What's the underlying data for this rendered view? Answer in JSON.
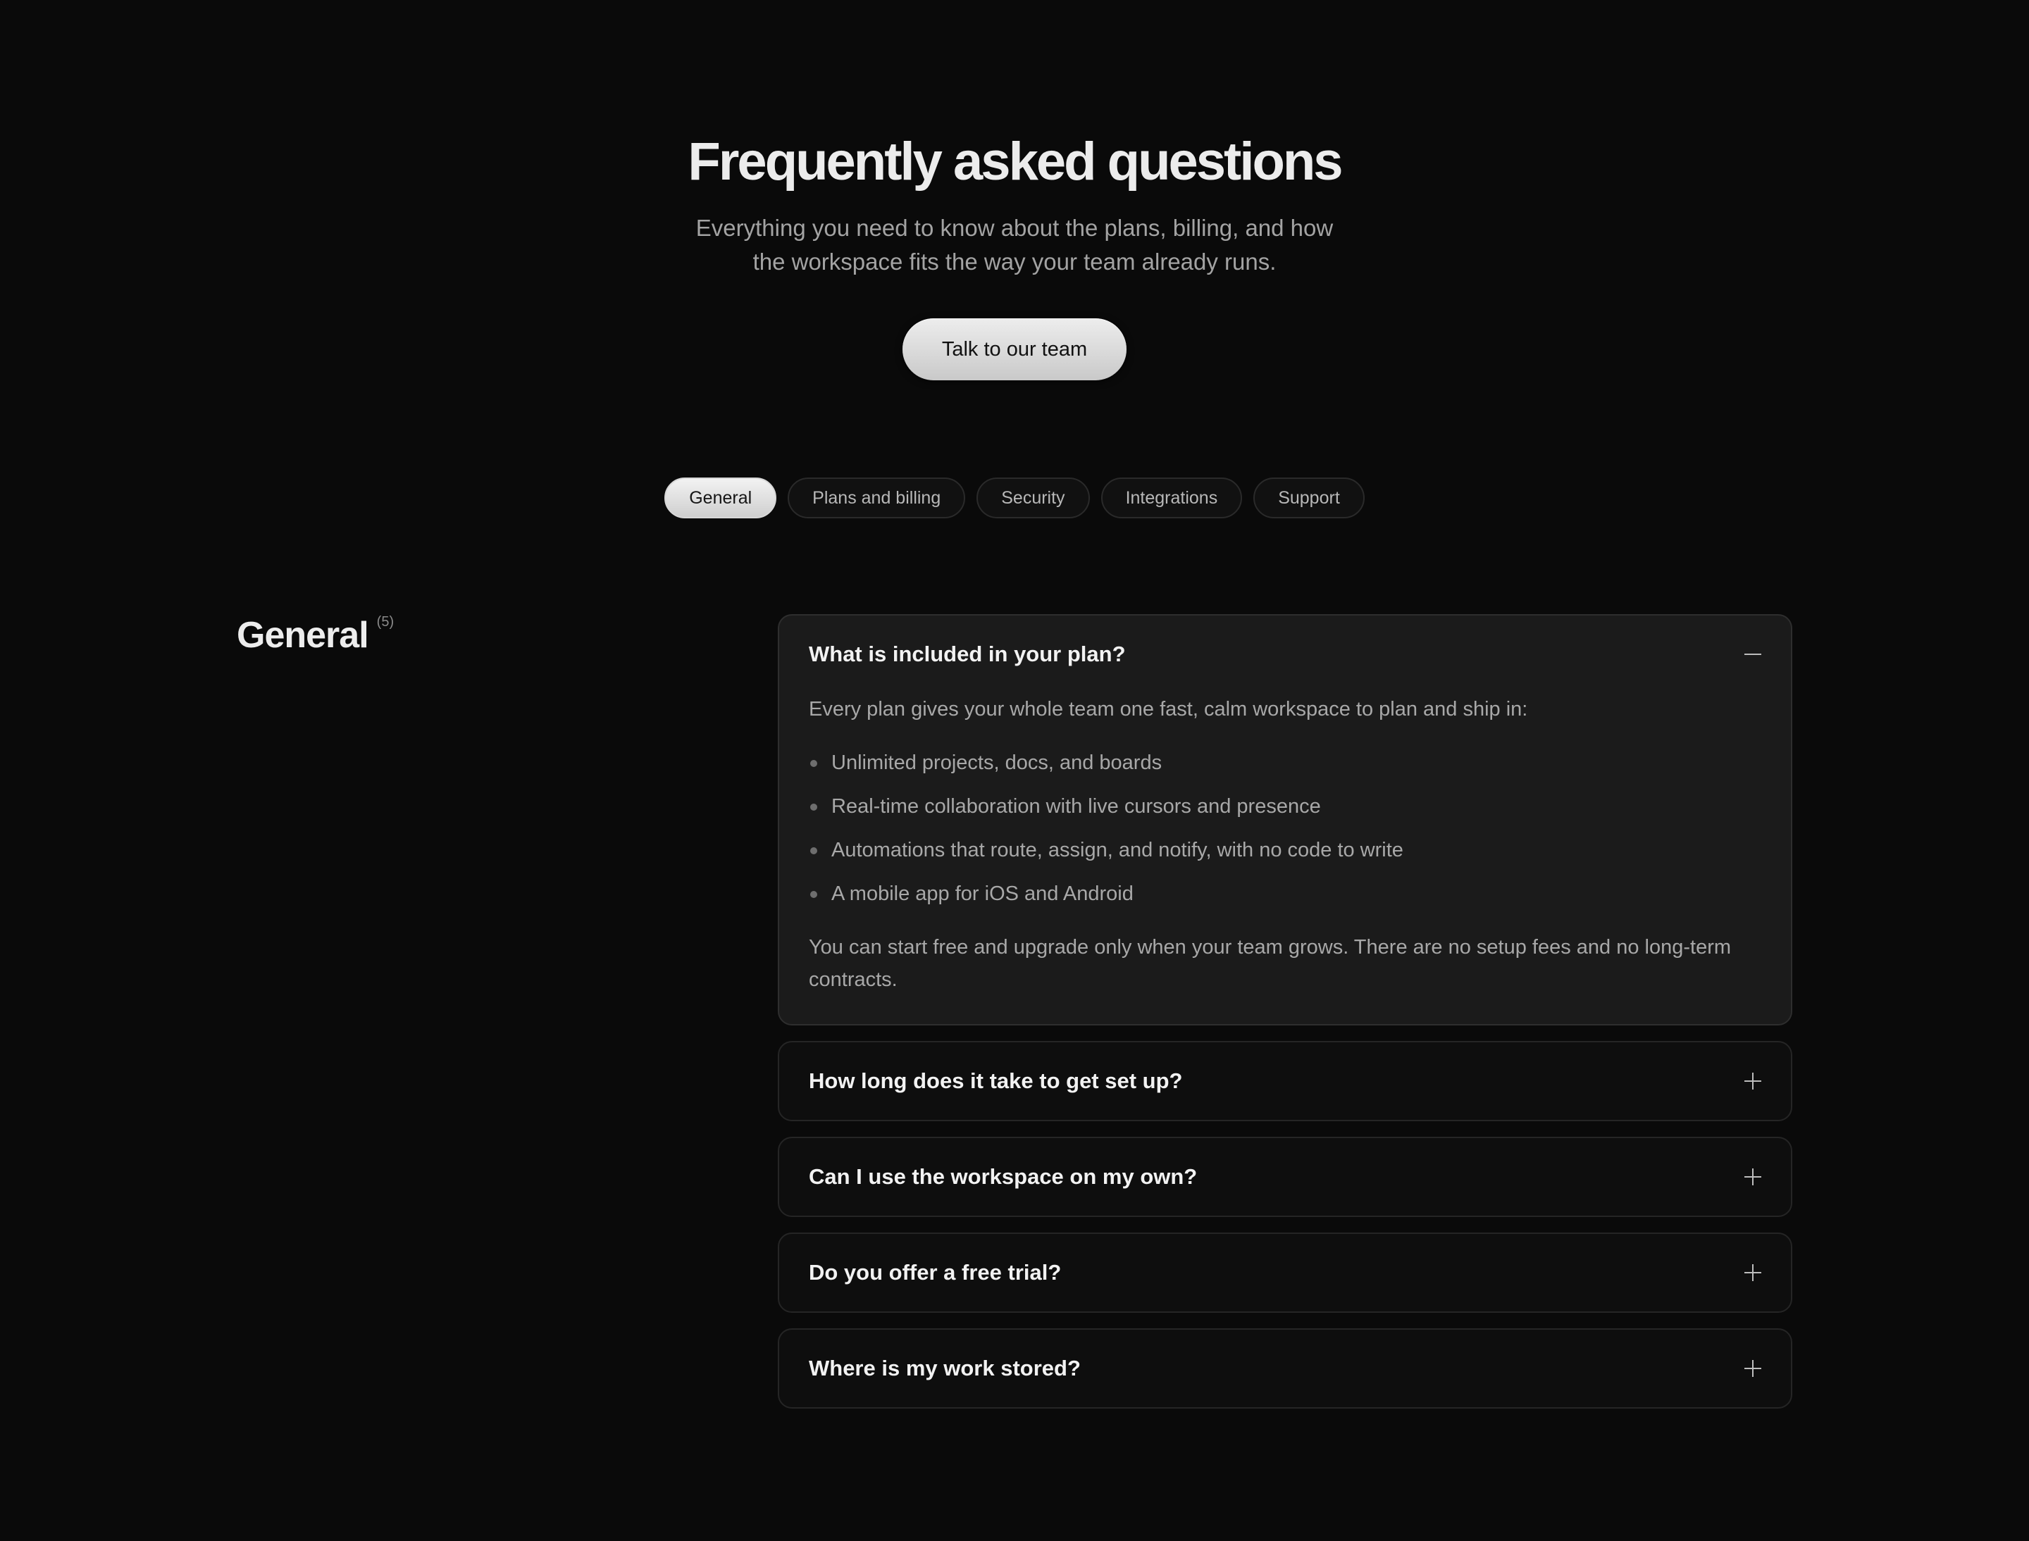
{
  "hero": {
    "title": "Frequently asked questions",
    "subtitle": "Everything you need to know about the plans, billing, and how the workspace fits the way your team already runs.",
    "cta_label": "Talk to our team"
  },
  "tabs": [
    {
      "label": "General",
      "active": true
    },
    {
      "label": "Plans and billing",
      "active": false
    },
    {
      "label": "Security",
      "active": false
    },
    {
      "label": "Integrations",
      "active": false
    },
    {
      "label": "Support",
      "active": false
    }
  ],
  "section": {
    "title": "General",
    "count": "(5)"
  },
  "faqs": [
    {
      "question": "What is included in your plan?",
      "icon": "minus-icon",
      "answer_intro": "Every plan gives your whole team one fast, calm workspace to plan and ship in:",
      "answer_points": [
        "Unlimited projects, docs, and boards",
        "Real-time collaboration with live cursors and presence",
        "Automations that route, assign, and notify, with no code to write",
        "A mobile app for iOS and Android"
      ],
      "answer_outro": "You can start free and upgrade only when your team grows. There are no setup fees and no long-term contracts."
    },
    {
      "question": "How long does it take to get set up?",
      "icon": "plus-icon"
    },
    {
      "question": "Can I use the workspace on my own?",
      "icon": "plus-icon"
    },
    {
      "question": "Do you offer a free trial?",
      "icon": "plus-icon"
    },
    {
      "question": "Where is my work stored?",
      "icon": "plus-icon"
    }
  ]
}
